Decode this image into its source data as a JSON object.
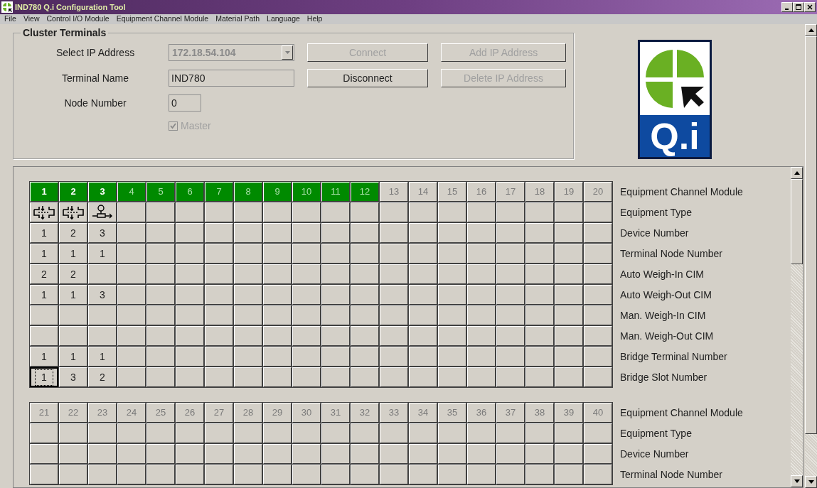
{
  "window": {
    "title": "IND780 Q.i Configuration Tool"
  },
  "menu": [
    "File",
    "View",
    "Control I/O Module",
    "Equipment Channel Module",
    "Material Path",
    "Language",
    "Help"
  ],
  "cluster_terminals": {
    "title": "Cluster Terminals",
    "fields": [
      {
        "label": "Select IP Address",
        "kind": "dropdown",
        "value": "172.18.54.104",
        "disabled": true
      },
      {
        "label": "Terminal Name",
        "kind": "text",
        "value": "IND780",
        "disabled": false
      },
      {
        "label": "Node Number",
        "kind": "text",
        "value": "0",
        "disabled": false
      }
    ],
    "master": {
      "label": "Master",
      "checked": true,
      "disabled": true
    },
    "buttons": [
      {
        "label": "Connect",
        "disabled": true
      },
      {
        "label": "Add IP Address",
        "disabled": true
      },
      {
        "label": "Disconnect",
        "disabled": false
      },
      {
        "label": "Delete IP Address",
        "disabled": true
      }
    ]
  },
  "logo": {
    "text": "Q.i"
  },
  "grids": [
    {
      "header_label": "Equipment Channel Module",
      "channels": [
        {
          "label": "1",
          "enabled": true,
          "configured": true
        },
        {
          "label": "2",
          "enabled": true,
          "configured": true
        },
        {
          "label": "3",
          "enabled": true,
          "configured": true
        },
        {
          "label": "4",
          "enabled": true,
          "configured": false
        },
        {
          "label": "5",
          "enabled": true,
          "configured": false
        },
        {
          "label": "6",
          "enabled": true,
          "configured": false
        },
        {
          "label": "7",
          "enabled": true,
          "configured": false
        },
        {
          "label": "8",
          "enabled": true,
          "configured": false
        },
        {
          "label": "9",
          "enabled": true,
          "configured": false
        },
        {
          "label": "10",
          "enabled": true,
          "configured": false
        },
        {
          "label": "11",
          "enabled": true,
          "configured": false
        },
        {
          "label": "12",
          "enabled": true,
          "configured": false
        },
        {
          "label": "13",
          "enabled": false,
          "configured": false
        },
        {
          "label": "14",
          "enabled": false,
          "configured": false
        },
        {
          "label": "15",
          "enabled": false,
          "configured": false
        },
        {
          "label": "16",
          "enabled": false,
          "configured": false
        },
        {
          "label": "17",
          "enabled": false,
          "configured": false
        },
        {
          "label": "18",
          "enabled": false,
          "configured": false
        },
        {
          "label": "19",
          "enabled": false,
          "configured": false
        },
        {
          "label": "20",
          "enabled": false,
          "configured": false
        }
      ],
      "rows": [
        {
          "label": "Equipment Type",
          "cells": [
            {
              "kind": "split"
            },
            {
              "kind": "split"
            },
            {
              "kind": "meter"
            }
          ]
        },
        {
          "label": "Device Number",
          "cells": [
            "1",
            "2",
            "3"
          ]
        },
        {
          "label": "Terminal Node Number",
          "cells": [
            "1",
            "1",
            "1"
          ]
        },
        {
          "label": "Auto Weigh-In CIM",
          "cells": [
            "2",
            "2"
          ]
        },
        {
          "label": "Auto Weigh-Out CIM",
          "cells": [
            "1",
            "1",
            "3"
          ]
        },
        {
          "label": "Man. Weigh-In CIM"
        },
        {
          "label": "Man. Weigh-Out CIM"
        },
        {
          "label": "Bridge Terminal Number",
          "cells": [
            "1",
            "1",
            "1"
          ]
        },
        {
          "label": "Bridge Slot Number",
          "cells": [
            {
              "value": "1",
              "focused": true
            },
            "3",
            "2"
          ]
        }
      ]
    },
    {
      "header_label": "Equipment Channel Module",
      "channels": [
        {
          "label": "21",
          "enabled": false,
          "configured": false
        },
        {
          "label": "22",
          "enabled": false,
          "configured": false
        },
        {
          "label": "23",
          "enabled": false,
          "configured": false
        },
        {
          "label": "24",
          "enabled": false,
          "configured": false
        },
        {
          "label": "25",
          "enabled": false,
          "configured": false
        },
        {
          "label": "26",
          "enabled": false,
          "configured": false
        },
        {
          "label": "27",
          "enabled": false,
          "configured": false
        },
        {
          "label": "28",
          "enabled": false,
          "configured": false
        },
        {
          "label": "29",
          "enabled": false,
          "configured": false
        },
        {
          "label": "30",
          "enabled": false,
          "configured": false
        },
        {
          "label": "31",
          "enabled": false,
          "configured": false
        },
        {
          "label": "32",
          "enabled": false,
          "configured": false
        },
        {
          "label": "33",
          "enabled": false,
          "configured": false
        },
        {
          "label": "34",
          "enabled": false,
          "configured": false
        },
        {
          "label": "35",
          "enabled": false,
          "configured": false
        },
        {
          "label": "36",
          "enabled": false,
          "configured": false
        },
        {
          "label": "37",
          "enabled": false,
          "configured": false
        },
        {
          "label": "38",
          "enabled": false,
          "configured": false
        },
        {
          "label": "39",
          "enabled": false,
          "configured": false
        },
        {
          "label": "40",
          "enabled": false,
          "configured": false
        }
      ],
      "rows": [
        {
          "label": "Equipment Type"
        },
        {
          "label": "Device Number"
        },
        {
          "label": "Terminal Node Number"
        }
      ]
    }
  ]
}
